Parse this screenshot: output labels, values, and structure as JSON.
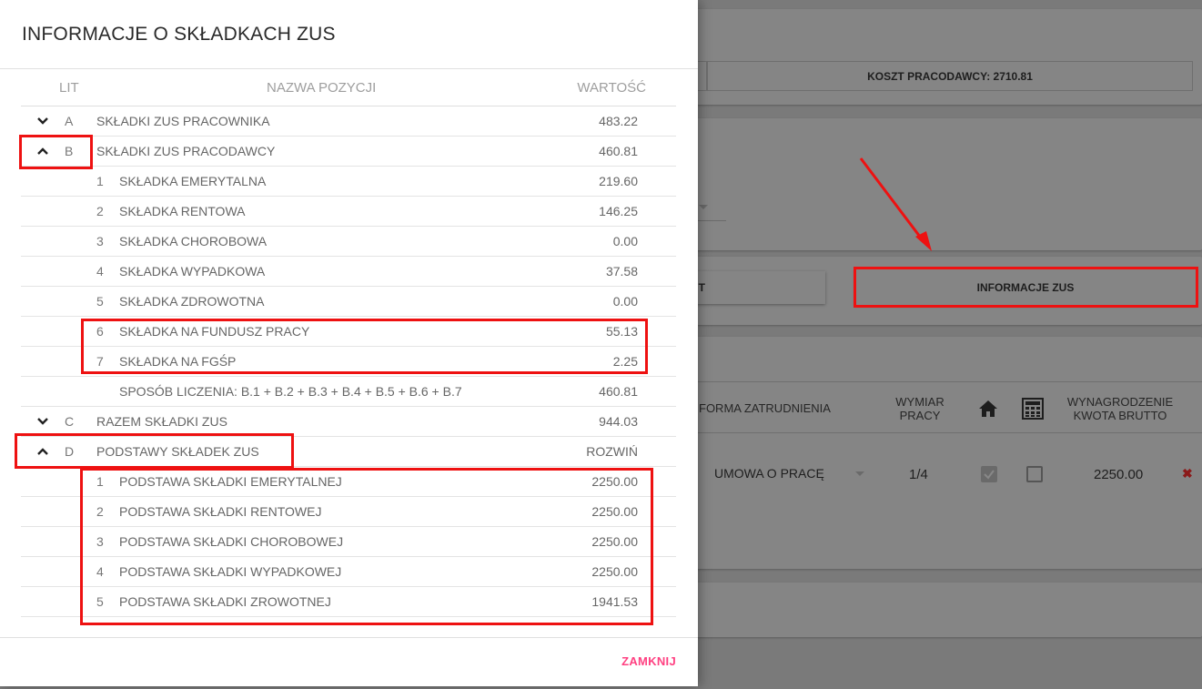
{
  "background": {
    "cost_label": "KOSZT PRACODAWCY: 2710.81",
    "info_button_label": "INFORMACJE ZUS",
    "left_button_label": "T",
    "columns": {
      "forma": "FORMA ZATRUDNIENIA",
      "wymiar": "WYMIAR PRACY",
      "wynagrodzenie": "WYNAGRODZENIE KWOTA BRUTTO"
    },
    "row": {
      "forma": "UMOWA O PRACĘ",
      "wymiar": "1/4",
      "brutto": "2250.00"
    },
    "icons": {
      "home": "home-icon",
      "calculator": "calculator-icon",
      "delete": "close-icon"
    }
  },
  "dialog": {
    "title": "INFORMACJE O SKŁADKACH ZUS",
    "columns": {
      "lit": "LIT",
      "name": "NAZWA POZYCJI",
      "value": "WARTOŚĆ"
    },
    "groups": {
      "a": {
        "lit": "A",
        "name": "SKŁADKI ZUS PRACOWNIKA",
        "value": "483.22",
        "expanded": false
      },
      "b": {
        "lit": "B",
        "name": "SKŁADKI ZUS PRACODAWCY",
        "value": "460.81",
        "expanded": true,
        "items": [
          {
            "idx": "1",
            "name": "SKŁADKA EMERYTALNA",
            "value": "219.60"
          },
          {
            "idx": "2",
            "name": "SKŁADKA RENTOWA",
            "value": "146.25"
          },
          {
            "idx": "3",
            "name": "SKŁADKA CHOROBOWA",
            "value": "0.00"
          },
          {
            "idx": "4",
            "name": "SKŁADKA WYPADKOWA",
            "value": "37.58"
          },
          {
            "idx": "5",
            "name": "SKŁADKA ZDROWOTNA",
            "value": "0.00"
          },
          {
            "idx": "6",
            "name": "SKŁADKA NA FUNDUSZ PRACY",
            "value": "55.13"
          },
          {
            "idx": "7",
            "name": "SKŁADKA NA FGŚP",
            "value": "2.25"
          }
        ],
        "formula": "SPOSÓB LICZENIA: B.1 + B.2 + B.3 + B.4 + B.5 + B.6 + B.7",
        "formula_value": "460.81"
      },
      "c": {
        "lit": "C",
        "name": "RAZEM SKŁADKI ZUS",
        "value": "944.03",
        "expanded": false
      },
      "d": {
        "lit": "D",
        "name": "PODSTAWY SKŁADEK ZUS",
        "value": "ROZWIŃ",
        "expanded": true,
        "items": [
          {
            "idx": "1",
            "name": "PODSTAWA SKŁADKI EMERYTALNEJ",
            "value": "2250.00"
          },
          {
            "idx": "2",
            "name": "PODSTAWA SKŁADKI RENTOWEJ",
            "value": "2250.00"
          },
          {
            "idx": "3",
            "name": "PODSTAWA SKŁADKI CHOROBOWEJ",
            "value": "2250.00"
          },
          {
            "idx": "4",
            "name": "PODSTAWA SKŁADKI WYPADKOWEJ",
            "value": "2250.00"
          },
          {
            "idx": "5",
            "name": "PODSTAWA SKŁADKI ZROWOTNEJ",
            "value": "1941.53"
          }
        ]
      }
    },
    "close_label": "ZAMKNIJ"
  },
  "colors": {
    "accent": "#ff4081",
    "annotation": "#ee1111",
    "overlay": "#7a7a7a"
  }
}
